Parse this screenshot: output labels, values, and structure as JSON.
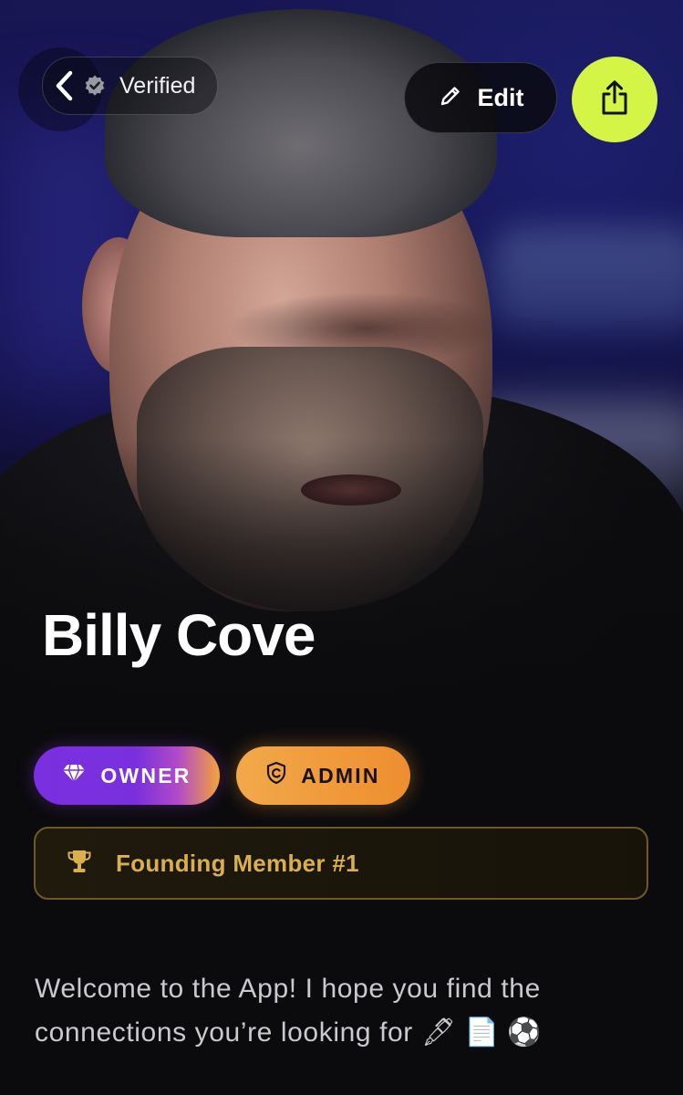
{
  "header": {
    "back_icon": "chevron-left-icon",
    "verified_icon": "verified-badge-icon",
    "verified_label": "Verified",
    "edit_icon": "pencil-icon",
    "edit_label": "Edit",
    "share_icon": "share-icon",
    "share_color": "#d4f545"
  },
  "profile": {
    "name": "Billy Cove",
    "photo": "profile-photo"
  },
  "badges": [
    {
      "label": "OWNER",
      "icon": "diamond-icon",
      "colors": [
        "#7a2fe0",
        "#f5a43a"
      ]
    },
    {
      "label": "ADMIN",
      "icon": "shield-icon",
      "colors": [
        "#f2a94a",
        "#ee8e2f"
      ]
    }
  ],
  "founding": {
    "icon": "trophy-icon",
    "label": "Founding Member #1",
    "color": "#d9b04c"
  },
  "bio": {
    "text": "Welcome to the App! I hope you find the connections you’re looking for 🖋 📄 ⚽"
  }
}
